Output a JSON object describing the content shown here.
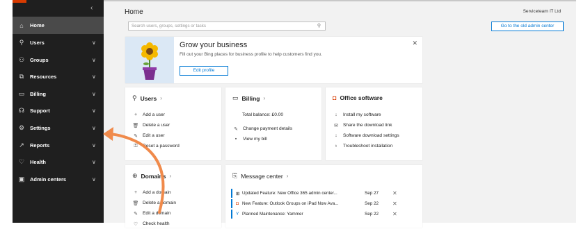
{
  "sidebar": {
    "items": [
      {
        "label": "Home",
        "icon": "home-icon",
        "glyph": "⌂",
        "active": true
      },
      {
        "label": "Users",
        "icon": "user-icon",
        "glyph": "⚲"
      },
      {
        "label": "Groups",
        "icon": "groups-icon",
        "glyph": "⚇"
      },
      {
        "label": "Resources",
        "icon": "resources-icon",
        "glyph": "⧉"
      },
      {
        "label": "Billing",
        "icon": "billing-icon",
        "glyph": "▭"
      },
      {
        "label": "Support",
        "icon": "support-icon",
        "glyph": "☊"
      },
      {
        "label": "Settings",
        "icon": "settings-icon",
        "glyph": "⚙"
      },
      {
        "label": "Reports",
        "icon": "reports-icon",
        "glyph": "↗"
      },
      {
        "label": "Health",
        "icon": "health-icon",
        "glyph": "♡"
      },
      {
        "label": "Admin centers",
        "icon": "admin-centers-icon",
        "glyph": "▣"
      }
    ]
  },
  "header": {
    "title": "Home",
    "tenant": "Serviceteam IT Ltd",
    "search_placeholder": "Search users, groups, settings or tasks",
    "old_admin_label": "Go to the old admin center"
  },
  "promo": {
    "title": "Grow your business",
    "description": "Fill out your Bing places for business profile to help customers find you.",
    "button": "Edit profile"
  },
  "users_card": {
    "title": "Users",
    "items": [
      {
        "label": "Add a user",
        "glyph": "+"
      },
      {
        "label": "Delete a user",
        "glyph": "🗑"
      },
      {
        "label": "Edit a user",
        "glyph": "✎"
      },
      {
        "label": "Reset a password",
        "glyph": "⚿"
      }
    ]
  },
  "billing_card": {
    "title": "Billing",
    "balance": "Total balance: £0.00",
    "items": [
      {
        "label": "Change payment details",
        "glyph": "✎"
      },
      {
        "label": "View my bill",
        "glyph": "▪"
      }
    ]
  },
  "office_card": {
    "title": "Office software",
    "items": [
      {
        "label": "Install my software",
        "glyph": "↓"
      },
      {
        "label": "Share the download link",
        "glyph": "✉"
      },
      {
        "label": "Software download settings",
        "glyph": "↓"
      },
      {
        "label": "Troubleshoot installation",
        "glyph": "♁"
      }
    ]
  },
  "domains_card": {
    "title": "Domains",
    "items": [
      {
        "label": "Add a domain",
        "glyph": "+"
      },
      {
        "label": "Delete a domain",
        "glyph": "🗑"
      },
      {
        "label": "Edit a domain",
        "glyph": "✎"
      },
      {
        "label": "Check health",
        "glyph": "♡"
      }
    ]
  },
  "message_center": {
    "title": "Message center",
    "messages": [
      {
        "text": "Updated Feature: New Office 365 admin center...",
        "glyph": "⊞",
        "date": "Sep 27"
      },
      {
        "text": "New Feature: Outlook Groups on iPad Now Ava...",
        "glyph": "◘",
        "date": "Sep 22"
      },
      {
        "text": "Planned Maintenance: Yammer",
        "glyph": "Y",
        "date": "Sep 22"
      }
    ]
  },
  "colors": {
    "accent": "#0078d4",
    "sidebar_bg": "#1f1f1f",
    "office_red": "#d83b01",
    "annotation_arrow": "#f08a4b"
  }
}
